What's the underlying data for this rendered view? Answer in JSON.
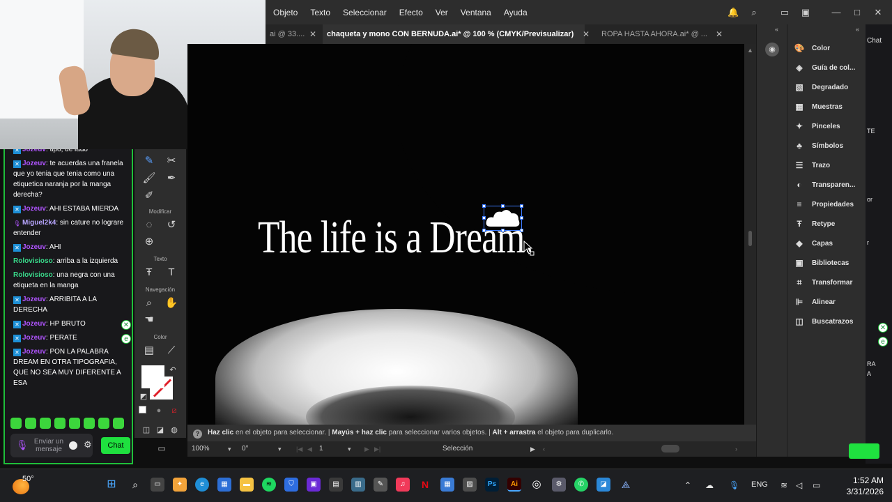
{
  "menu": [
    "Objeto",
    "Texto",
    "Seleccionar",
    "Efecto",
    "Ver",
    "Ventana",
    "Ayuda"
  ],
  "tabs": [
    {
      "label": "ai @ 33...."
    },
    {
      "label": "chaqueta y mono CON BERNUDA.ai* @ 100 % (CMYK/Previsualizar)"
    },
    {
      "label": "ROPA HASTA AHORA.ai* @ ..."
    }
  ],
  "tools": {
    "modificar": "Modificar",
    "texto": "Texto",
    "navegacion": "Navegación",
    "color": "Color"
  },
  "canvas": {
    "text": "The life is a Dream."
  },
  "status": {
    "p1_bold": "Haz clic",
    "p1": " en el objeto para seleccionar.  |  ",
    "p2_bold": "Mayús + haz clic",
    "p2": " para seleccionar varios objetos.  |  ",
    "p3_bold": "Alt + arrastra",
    "p3": " el objeto para duplicarlo."
  },
  "bottombar": {
    "zoom": "100%",
    "angle": "0°",
    "artboard": "1",
    "tool": "Selección"
  },
  "panels": [
    {
      "label": "Color",
      "icon": "palette-icon"
    },
    {
      "label": "Guía de col...",
      "icon": "color-guide-icon"
    },
    {
      "label": "Degradado",
      "icon": "gradient-icon"
    },
    {
      "label": "Muestras",
      "icon": "swatches-icon"
    },
    {
      "label": "Pinceles",
      "icon": "brush-icon"
    },
    {
      "label": "Símbolos",
      "icon": "symbols-icon"
    },
    {
      "label": "Trazo",
      "icon": "stroke-icon"
    },
    {
      "label": "Transparen...",
      "icon": "transparency-icon"
    },
    {
      "label": "Propiedades",
      "icon": "properties-icon"
    },
    {
      "label": "Retype",
      "icon": "retype-icon"
    },
    {
      "label": "Capas",
      "icon": "layers-icon"
    },
    {
      "label": "Bibliotecas",
      "icon": "libraries-icon"
    },
    {
      "label": "Transformar",
      "icon": "transform-icon"
    },
    {
      "label": "Alinear",
      "icon": "align-icon"
    },
    {
      "label": "Buscatrazos",
      "icon": "pathfinder-icon"
    }
  ],
  "chat": {
    "messages": [
      {
        "user": "Jozeuv",
        "text": ": tipo, de lado",
        "color": "#b054ff",
        "badge": "x"
      },
      {
        "user": "Jozeuv",
        "text": ": te acuerdas una franela que yo tenia que tenia como una etiquetica naranja por la manga derecha?",
        "color": "#b054ff",
        "badge": "x"
      },
      {
        "user": "Jozeuv",
        "text": ": AHI ESTABA MIERDA",
        "color": "#b054ff",
        "badge": "x"
      },
      {
        "user": "Miguel2k4",
        "text": ": sin cature no lograre entender",
        "color": "#b8a6ff",
        "badge": "mic"
      },
      {
        "user": "Jozeuv",
        "text": ": AHI",
        "color": "#b054ff",
        "badge": "x"
      },
      {
        "user": "Rolovisioso",
        "text": ": arriba a la izquierda",
        "color": "#39d98a",
        "badge": ""
      },
      {
        "user": "Rolovisioso",
        "text": ": una negra con una etiqueta en la manga",
        "color": "#39d98a",
        "badge": ""
      },
      {
        "user": "Jozeuv",
        "text": ": ARRIBITA A LA DERECHA",
        "color": "#b054ff",
        "badge": "x"
      },
      {
        "user": "Jozeuv",
        "text": ": HP BRUTO",
        "color": "#b054ff",
        "badge": "x"
      },
      {
        "user": "Jozeuv",
        "text": ": PERATE",
        "color": "#b054ff",
        "badge": "x"
      },
      {
        "user": "Jozeuv",
        "text": ": PON LA PALABRA DREAM EN OTRA TIPOGRAFIA, QUE NO SEA MUY DIFERENTE A ESA",
        "color": "#b054ff",
        "badge": "x"
      }
    ],
    "placeholder": "Enviar un mensaje",
    "button": "Chat"
  },
  "farright": {
    "chat_label": "Chat",
    "text1": "TE",
    "text2": "or",
    "text3": "r",
    "text4": "RA",
    "text5": "A"
  },
  "taskbar": {
    "temp": "50°",
    "lang": "ENG",
    "time": "1:52 AM",
    "date": "3/31/2026"
  },
  "colors": {
    "accent": "#1fe03f",
    "selection": "#3c7bff"
  }
}
